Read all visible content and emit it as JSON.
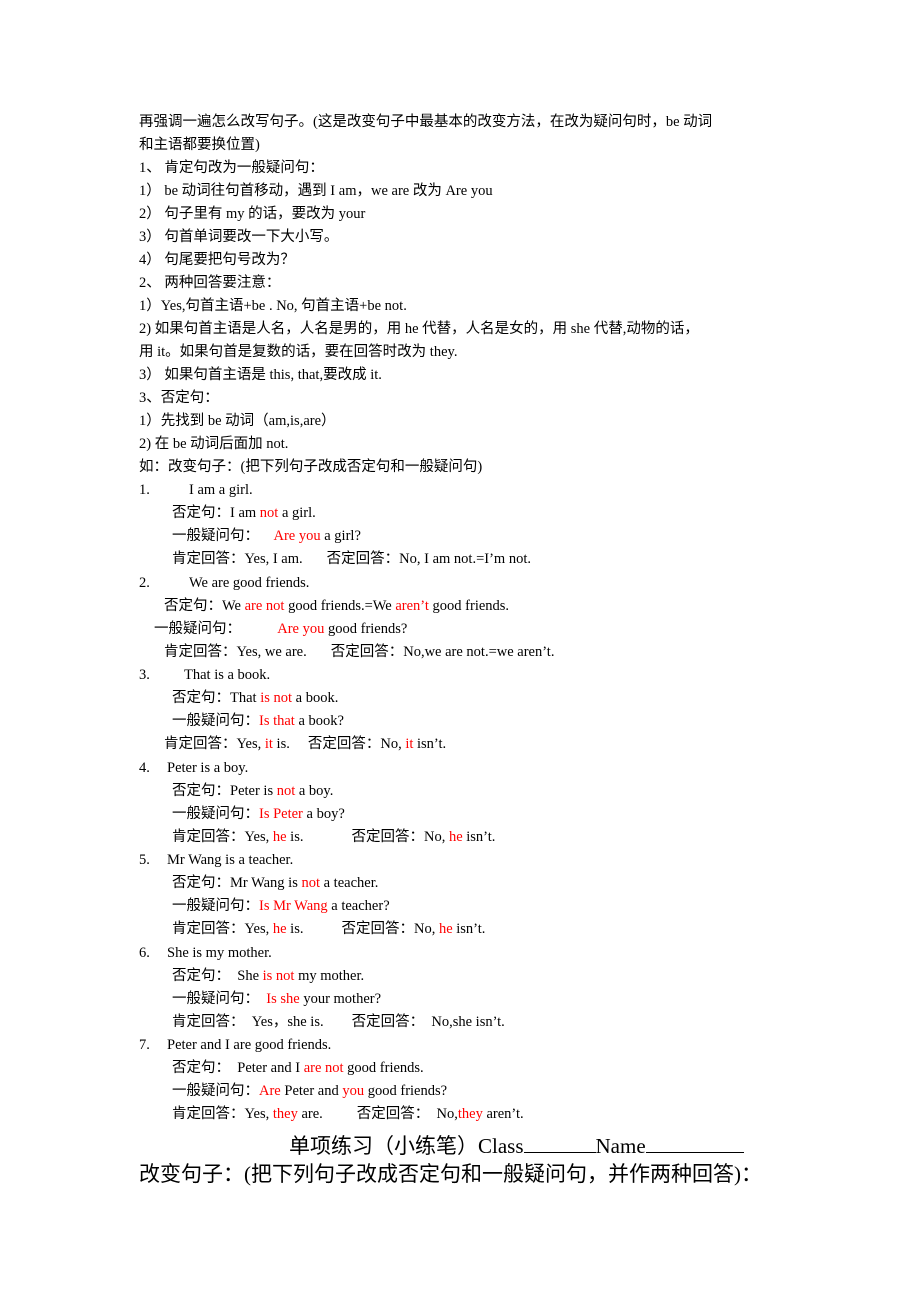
{
  "intro": {
    "line1": "再强调一遍怎么改写句子。(这是改变句子中最基本的改变方法，在改为疑问句时，be  动词",
    "line2": "和主语都要换位置)"
  },
  "rules": [
    {
      "heading": "1、 肯定句改为一般疑问句：",
      "items": [
        "1） be  动词往句首移动，遇到  I am，we are  改为 Are you",
        "2） 句子里有 my 的话，要改为 your",
        "3） 句首单词要改一下大小写。",
        "4） 句尾要把句号改为？"
      ]
    },
    {
      "heading": "2、 两种回答要注意：",
      "items": [
        "1）Yes,句首主语+be . No,      句首主语+be not.",
        "2)    如果句首主语是人名，人名是男的，用 he  代替，人名是女的，用 she  代替,动物的话，",
        "用 it。如果句首是复数的话，要在回答时改为 they.",
        "3）   如果句首主语是 this, that,要改成 it."
      ]
    },
    {
      "heading": "3、否定句：",
      "items": [
        "1）先找到 be 动词（am,is,are）",
        "2)    在 be  动词后面加 not."
      ]
    }
  ],
  "example_heading": "如：改变句子：(把下列句子改成否定句和一般疑问句)",
  "labels": {
    "negative": "否定句：",
    "question": "一般疑问句：",
    "yes_answer": "肯定回答：",
    "no_answer": "否定回答："
  },
  "accent_color": "#ff0000",
  "examples": [
    {
      "num": "1.",
      "sentence": "I am a girl.",
      "neg": [
        [
          "I am ",
          false
        ],
        [
          "not",
          true
        ],
        [
          " a girl.",
          false
        ]
      ],
      "q": [
        [
          "Are you",
          true
        ],
        [
          " a girl?",
          false
        ]
      ],
      "yes": [
        [
          "Yes, I am.",
          false
        ]
      ],
      "no": [
        [
          "No, I am not.=I’m not.",
          false
        ]
      ]
    },
    {
      "num": "2.",
      "sentence": "We are good friends.",
      "neg": [
        [
          "We ",
          false
        ],
        [
          "are not",
          true
        ],
        [
          " good friends.=We ",
          false
        ],
        [
          "aren’t",
          true
        ],
        [
          " good friends.",
          false
        ]
      ],
      "q": [
        [
          "Are you",
          true
        ],
        [
          " good friends?",
          false
        ]
      ],
      "yes": [
        [
          "Yes, we are.",
          false
        ]
      ],
      "no": [
        [
          "No,we are not.=we aren’t.",
          false
        ]
      ]
    },
    {
      "num": "3.",
      "sentence": "That is a book.",
      "neg": [
        [
          "That ",
          false
        ],
        [
          "is not",
          true
        ],
        [
          " a book.",
          false
        ]
      ],
      "q": [
        [
          "Is that",
          true
        ],
        [
          " a book?",
          false
        ]
      ],
      "yes": [
        [
          "Yes, ",
          false
        ],
        [
          "it",
          true
        ],
        [
          " is.",
          false
        ]
      ],
      "no": [
        [
          "No, ",
          false
        ],
        [
          "it",
          true
        ],
        [
          " isn’t.",
          false
        ]
      ]
    },
    {
      "num": "4.",
      "sentence": "Peter is a boy.",
      "neg": [
        [
          "Peter is ",
          false
        ],
        [
          "not",
          true
        ],
        [
          " a boy.",
          false
        ]
      ],
      "q": [
        [
          "Is Peter",
          true
        ],
        [
          " a boy?",
          false
        ]
      ],
      "yes": [
        [
          "Yes, ",
          false
        ],
        [
          "he",
          true
        ],
        [
          " is.",
          false
        ]
      ],
      "no": [
        [
          "No, ",
          false
        ],
        [
          "he",
          true
        ],
        [
          " isn’t.",
          false
        ]
      ]
    },
    {
      "num": "5.",
      "sentence": "Mr Wang is a teacher.",
      "neg": [
        [
          "Mr Wang is ",
          false
        ],
        [
          "not",
          true
        ],
        [
          " a teacher.",
          false
        ]
      ],
      "q": [
        [
          "Is Mr Wang",
          true
        ],
        [
          " a teacher?",
          false
        ]
      ],
      "yes": [
        [
          "Yes, ",
          false
        ],
        [
          "he",
          true
        ],
        [
          " is.",
          false
        ]
      ],
      "no": [
        [
          "No, ",
          false
        ],
        [
          "he",
          true
        ],
        [
          " isn’t.",
          false
        ]
      ]
    },
    {
      "num": "6.",
      "sentence": "She is my mother.",
      "neg": [
        [
          "  She ",
          false
        ],
        [
          "is not",
          true
        ],
        [
          " my mother.",
          false
        ]
      ],
      "q": [
        [
          "  ",
          false
        ],
        [
          "Is she",
          true
        ],
        [
          " your mother?",
          false
        ]
      ],
      "yes": [
        [
          "  Yes，she is.",
          false
        ]
      ],
      "no": [
        [
          "  No,she isn’t.",
          false
        ]
      ]
    },
    {
      "num": "7.",
      "sentence": "Peter and I are good friends.",
      "neg": [
        [
          "  Peter and I ",
          false
        ],
        [
          "are not",
          true
        ],
        [
          " good friends.",
          false
        ]
      ],
      "q": [
        [
          "Are",
          true
        ],
        [
          " Peter and ",
          false
        ],
        [
          "you",
          true
        ],
        [
          " good friends?",
          false
        ]
      ],
      "yes": [
        [
          "Yes, ",
          false
        ],
        [
          "they",
          true
        ],
        [
          " are.",
          false
        ]
      ],
      "no": [
        [
          "  No,",
          false
        ],
        [
          "they",
          true
        ],
        [
          " aren’t.",
          false
        ]
      ]
    }
  ],
  "exercise": {
    "title": "单项练习（小练笔）",
    "class_label": "Class",
    "name_label": "Name",
    "instruction": "改变句子：(把下列句子改成否定句和一般疑问句，并作两种回答)："
  }
}
